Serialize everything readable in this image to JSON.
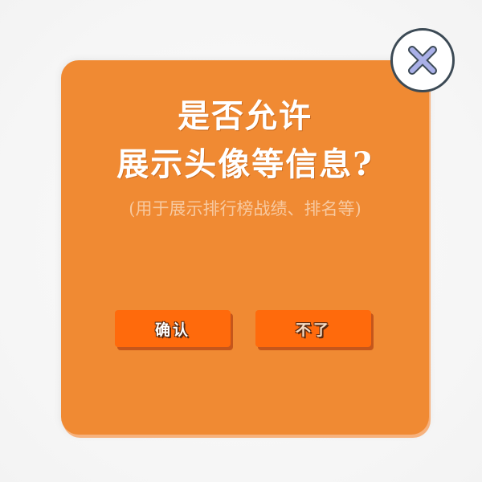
{
  "dialog": {
    "title_line1": "是否允许",
    "title_line2": "展示头像等信息?",
    "subtitle": "(用于展示排行榜战绩、排名等)",
    "confirm_label": "确认",
    "decline_label": "不了"
  },
  "close": {
    "icon": "close-icon"
  },
  "colors": {
    "dialog_bg": "#f08a33",
    "button_bg": "#ff6a0c",
    "close_icon": "#aab0e8",
    "close_border": "#3c4a55"
  }
}
